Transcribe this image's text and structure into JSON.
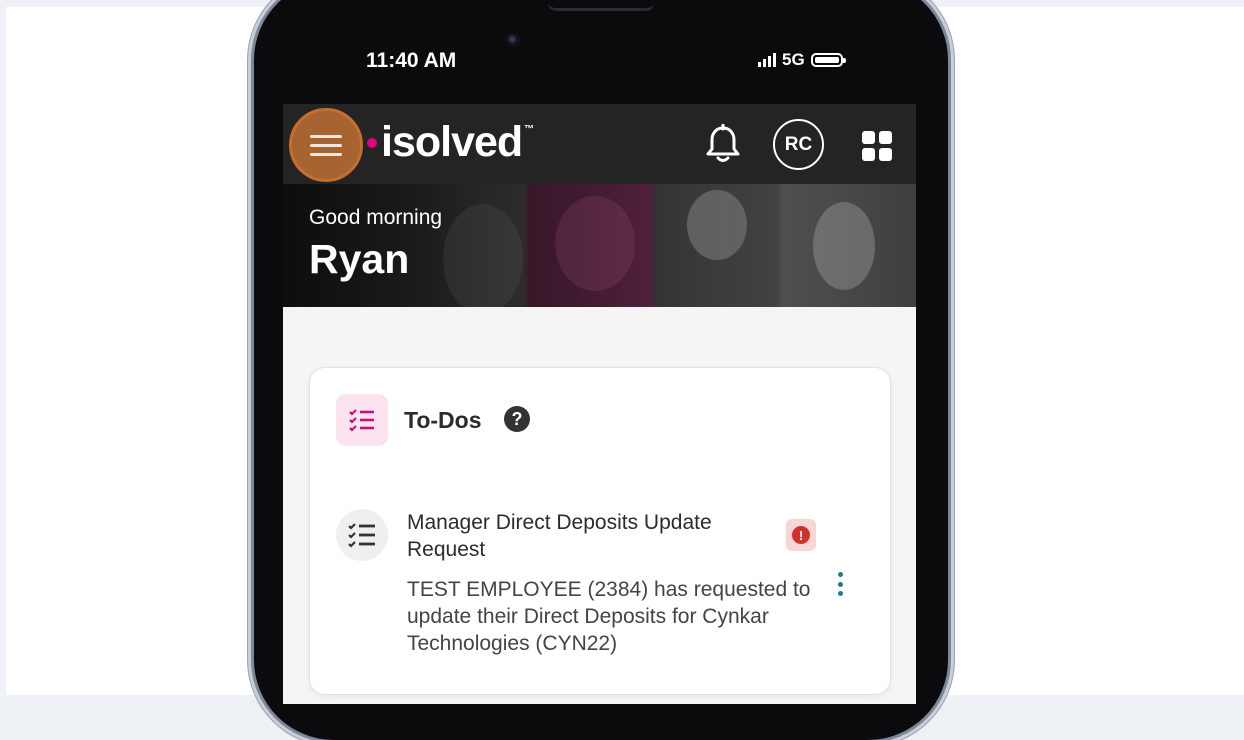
{
  "status_bar": {
    "time": "11:40 AM",
    "network": "5G"
  },
  "header": {
    "logo_text": "isolved",
    "avatar_initials": "RC",
    "icons": [
      "menu-icon",
      "bell-icon",
      "apps-grid-icon"
    ],
    "accent_color": "#e6007e"
  },
  "banner": {
    "greeting": "Good morning",
    "name": "Ryan"
  },
  "todos": {
    "title": "To-Dos",
    "help_symbol": "?",
    "items": [
      {
        "title": "Manager Direct Deposits Update Request",
        "description": "TEST EMPLOYEE (2384) has requested to update their Direct Deposits for Cynkar Technologies (CYN22)",
        "alert_symbol": "!",
        "alert_color": "#d0312d"
      }
    ]
  }
}
